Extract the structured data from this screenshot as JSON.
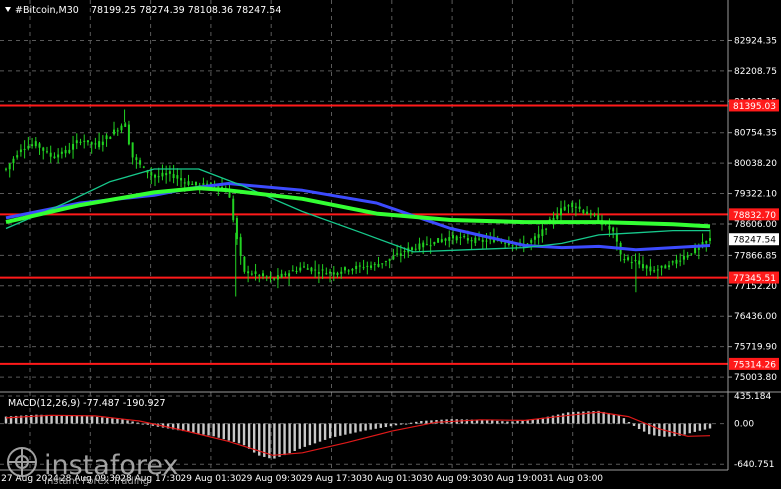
{
  "header": {
    "title": "#Bitcoin,M30",
    "ohlc": "78199.25 78274.39 78108.36 78247.54"
  },
  "watermark": {
    "brand": "instaforex",
    "tagline": "Instant Forex Trading"
  },
  "colors": {
    "background": "#000000",
    "grid": "#5a5a5a",
    "candle": "#22d322",
    "level_line": "#ff1a1a",
    "ma_fast": "#3c4bff",
    "ma_mid": "#17c98c",
    "ma_slow": "#33ff33",
    "macd_hist": "#c8c8c8",
    "macd_signal": "#e01919",
    "price_tag_current": "#ffffff"
  },
  "chart_data": [
    {
      "type": "line",
      "name": "#Bitcoin,M30",
      "ylim": [
        74700,
        83500
      ],
      "y_ticks": [
        "82924.35",
        "82208.75",
        "81493.15",
        "80754.35",
        "80038.20",
        "79322.10",
        "78606.00",
        "77866.85",
        "77152.20",
        "76436.00",
        "75719.90",
        "75003.80"
      ],
      "x_ticks": [
        "27 Aug 2024",
        "28 Aug 09:30",
        "28 Aug 17:30",
        "29 Aug 01:30",
        "29 Aug 09:30",
        "29 Aug 17:30",
        "30 Aug 01:30",
        "30 Aug 09:30",
        "30 Aug 19:00",
        "31 Aug 03:00"
      ],
      "close_points": [
        [
          0,
          79900
        ],
        [
          2,
          80400
        ],
        [
          4,
          80500
        ],
        [
          6,
          80200
        ],
        [
          8,
          80300
        ],
        [
          10,
          80600
        ],
        [
          12,
          80450
        ],
        [
          14,
          80700
        ],
        [
          16,
          81000
        ],
        [
          17,
          80200
        ],
        [
          18,
          80000
        ],
        [
          20,
          79700
        ],
        [
          22,
          79800
        ],
        [
          24,
          79600
        ],
        [
          26,
          79500
        ],
        [
          28,
          79550
        ],
        [
          30,
          79350
        ],
        [
          31,
          78400
        ],
        [
          32,
          77500
        ],
        [
          34,
          77400
        ],
        [
          36,
          77300
        ],
        [
          38,
          77450
        ],
        [
          40,
          77600
        ],
        [
          42,
          77500
        ],
        [
          44,
          77450
        ],
        [
          46,
          77550
        ],
        [
          48,
          77600
        ],
        [
          50,
          77650
        ],
        [
          52,
          77800
        ],
        [
          54,
          78000
        ],
        [
          56,
          78100
        ],
        [
          58,
          78200
        ],
        [
          60,
          78300
        ],
        [
          62,
          78250
        ],
        [
          64,
          78200
        ],
        [
          66,
          78250
        ],
        [
          68,
          78150
        ],
        [
          70,
          78100
        ],
        [
          72,
          78350
        ],
        [
          74,
          78800
        ],
        [
          76,
          79100
        ],
        [
          78,
          78900
        ],
        [
          80,
          78700
        ],
        [
          82,
          78400
        ],
        [
          83,
          77800
        ],
        [
          85,
          77700
        ],
        [
          87,
          77500
        ],
        [
          89,
          77600
        ],
        [
          91,
          77800
        ],
        [
          93,
          78000
        ],
        [
          95,
          78247.54
        ]
      ],
      "levels": [
        {
          "value": 81395.03,
          "label": "81395.03"
        },
        {
          "value": 78832.7,
          "label": "78832.70"
        },
        {
          "value": 77345.51,
          "label": "77345.51"
        },
        {
          "value": 75314.26,
          "label": "75314.26"
        }
      ],
      "current_price": {
        "value": 78247.54,
        "label": "78247.54"
      },
      "series": [
        {
          "values": [
            [
              0,
              78750
            ],
            [
              10,
              79100
            ],
            [
              20,
              79280
            ],
            [
              25,
              79450
            ],
            [
              30,
              79560
            ],
            [
              40,
              79400
            ],
            [
              50,
              79100
            ],
            [
              55,
              78800
            ],
            [
              60,
              78500
            ],
            [
              65,
              78300
            ],
            [
              70,
              78100
            ],
            [
              75,
              78050
            ],
            [
              80,
              78080
            ],
            [
              85,
              78000
            ],
            [
              90,
              78050
            ],
            [
              95,
              78100
            ]
          ]
        },
        {
          "values": [
            [
              0,
              78500
            ],
            [
              8,
              79100
            ],
            [
              14,
              79600
            ],
            [
              20,
              79900
            ],
            [
              26,
              79900
            ],
            [
              32,
              79500
            ],
            [
              40,
              78900
            ],
            [
              48,
              78400
            ],
            [
              55,
              77950
            ],
            [
              62,
              78000
            ],
            [
              70,
              78050
            ],
            [
              75,
              78150
            ],
            [
              80,
              78350
            ],
            [
              85,
              78400
            ],
            [
              90,
              78450
            ],
            [
              95,
              78450
            ]
          ]
        },
        {
          "values": [
            [
              0,
              78650
            ],
            [
              10,
              79050
            ],
            [
              20,
              79350
            ],
            [
              26,
              79450
            ],
            [
              30,
              79400
            ],
            [
              40,
              79200
            ],
            [
              50,
              78850
            ],
            [
              60,
              78700
            ],
            [
              70,
              78650
            ],
            [
              80,
              78650
            ],
            [
              90,
              78600
            ],
            [
              95,
              78550
            ]
          ]
        }
      ]
    },
    {
      "type": "bar",
      "name": "MACD(12,26,9)",
      "title": "MACD(12,26,9) -77.487 -190.927",
      "ylim": [
        -700,
        450
      ],
      "y_ticks": [
        "435.184",
        "0.00",
        "-640.751"
      ],
      "histogram_points": [
        [
          0,
          110
        ],
        [
          4,
          140
        ],
        [
          8,
          130
        ],
        [
          12,
          110
        ],
        [
          16,
          60
        ],
        [
          20,
          -40
        ],
        [
          24,
          -120
        ],
        [
          28,
          -200
        ],
        [
          32,
          -330
        ],
        [
          34,
          -500
        ],
        [
          36,
          -560
        ],
        [
          38,
          -480
        ],
        [
          40,
          -380
        ],
        [
          44,
          -220
        ],
        [
          48,
          -120
        ],
        [
          52,
          -40
        ],
        [
          56,
          40
        ],
        [
          60,
          70
        ],
        [
          64,
          60
        ],
        [
          68,
          30
        ],
        [
          72,
          80
        ],
        [
          76,
          180
        ],
        [
          80,
          200
        ],
        [
          83,
          120
        ],
        [
          85,
          -60
        ],
        [
          87,
          -180
        ],
        [
          89,
          -210
        ],
        [
          91,
          -190
        ],
        [
          93,
          -130
        ],
        [
          95,
          -77.487
        ]
      ],
      "signal_points": [
        [
          0,
          90
        ],
        [
          6,
          130
        ],
        [
          12,
          120
        ],
        [
          18,
          40
        ],
        [
          24,
          -110
        ],
        [
          30,
          -280
        ],
        [
          36,
          -500
        ],
        [
          40,
          -460
        ],
        [
          46,
          -300
        ],
        [
          52,
          -120
        ],
        [
          58,
          20
        ],
        [
          64,
          60
        ],
        [
          70,
          50
        ],
        [
          76,
          130
        ],
        [
          80,
          180
        ],
        [
          84,
          110
        ],
        [
          88,
          -80
        ],
        [
          92,
          -200
        ],
        [
          95,
          -190.927
        ]
      ]
    }
  ]
}
